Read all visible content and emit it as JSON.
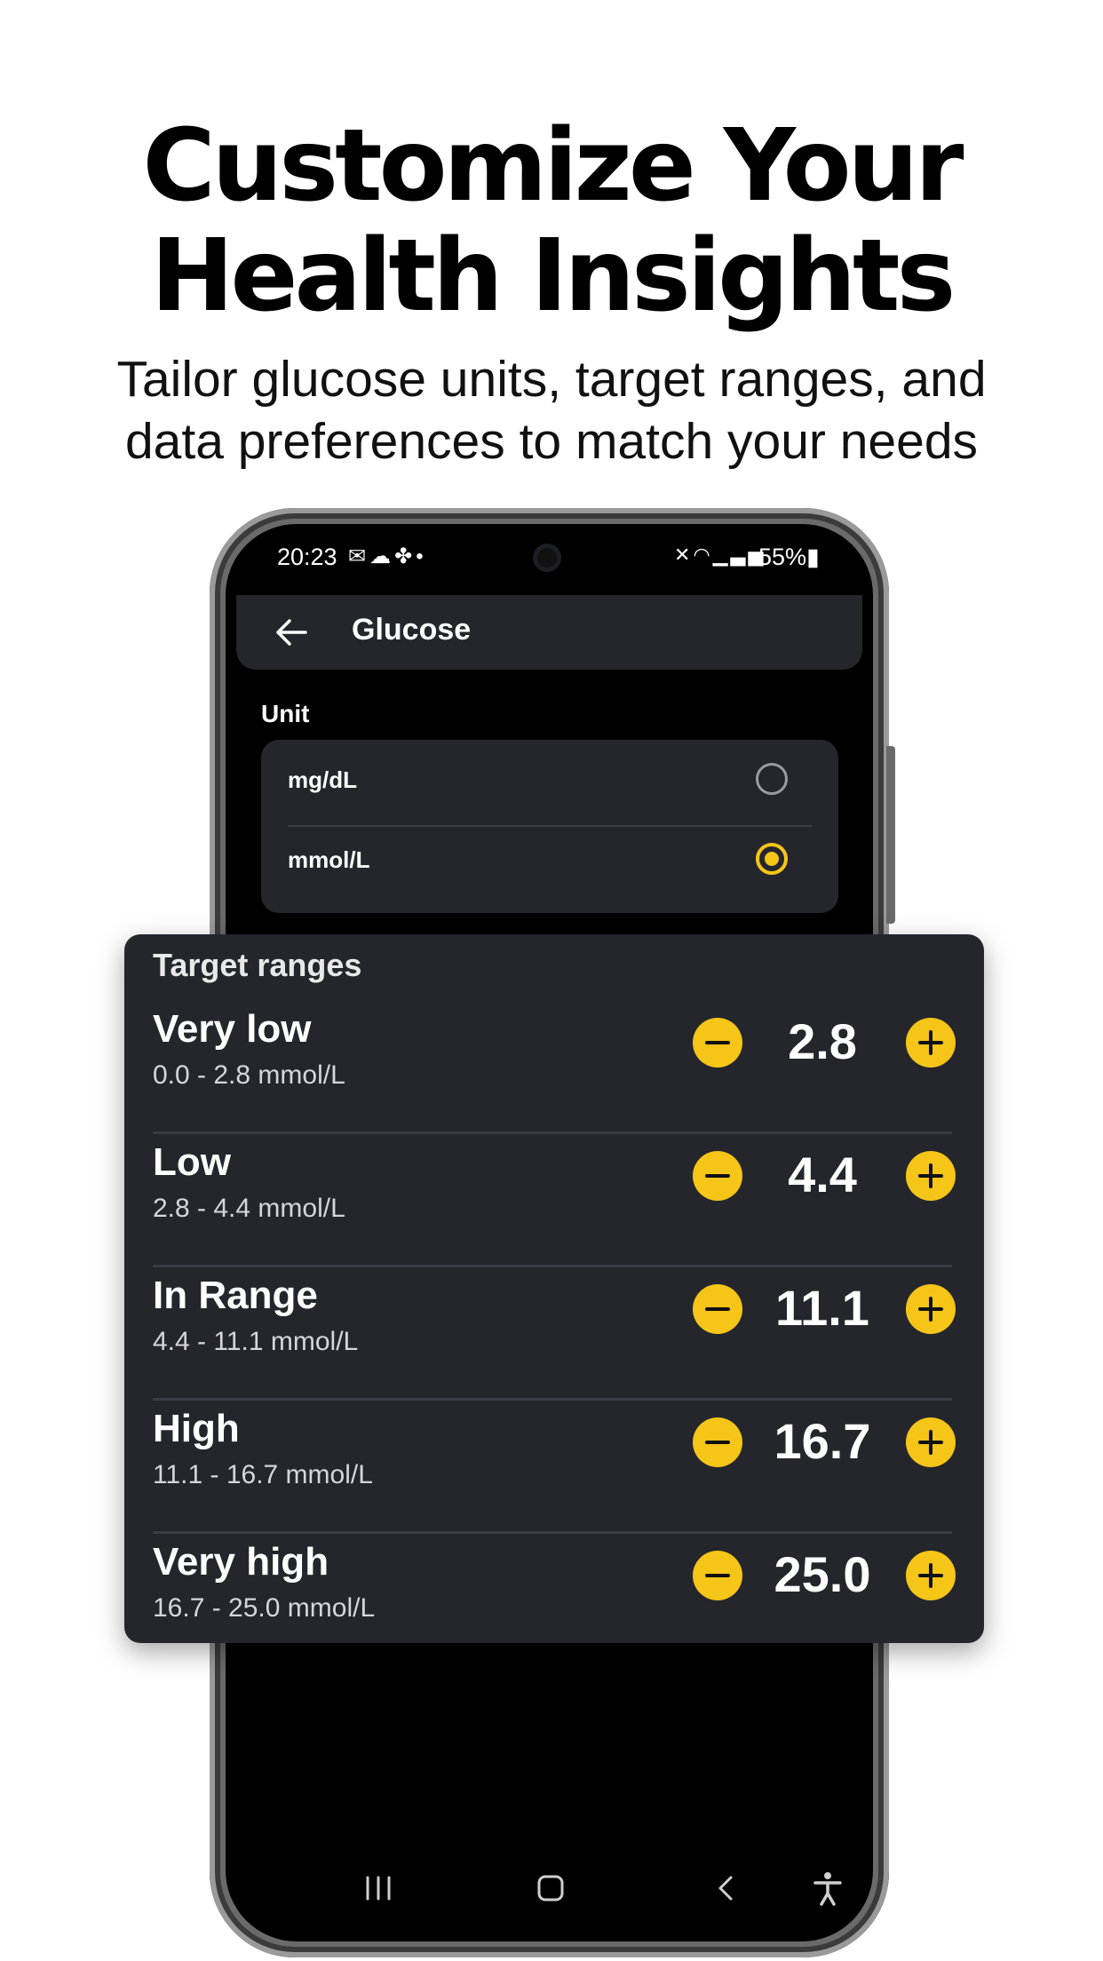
{
  "marketing": {
    "headline_line1": "Customize Your",
    "headline_line2": "Health Insights",
    "subhead_line1": "Tailor glucose units, target ranges, and",
    "subhead_line2": "data preferences to match your needs"
  },
  "status_bar": {
    "time": "20:23",
    "battery": "55%",
    "notification_icons": [
      "mail-icon",
      "weather-icon",
      "fan-icon",
      "dot-icon"
    ],
    "system_icons": [
      "mute-icon",
      "wifi-icon",
      "signal-icon",
      "battery-icon"
    ]
  },
  "app_bar": {
    "title": "Glucose",
    "back_icon": "arrow-left-icon"
  },
  "unit_section": {
    "label": "Unit",
    "options": [
      {
        "label": "mg/dL",
        "selected": false
      },
      {
        "label": "mmol/L",
        "selected": true
      }
    ]
  },
  "target_ranges": {
    "title": "Target ranges",
    "rows": [
      {
        "name": "Very low",
        "range": "0.0 - 2.8 mmol/L",
        "value": "2.8"
      },
      {
        "name": "Low",
        "range": "2.8 - 4.4 mmol/L",
        "value": "4.4"
      },
      {
        "name": "In Range",
        "range": "4.4 - 11.1 mmol/L",
        "value": "11.1"
      },
      {
        "name": "High",
        "range": "11.1 - 16.7 mmol/L",
        "value": "16.7"
      },
      {
        "name": "Very high",
        "range": "16.7 - 25.0 mmol/L",
        "value": "25.0"
      }
    ]
  },
  "colors": {
    "accent": "#f5c518",
    "card": "#25262c",
    "screen_bg": "#000000",
    "page_bg": "#ffffff"
  }
}
